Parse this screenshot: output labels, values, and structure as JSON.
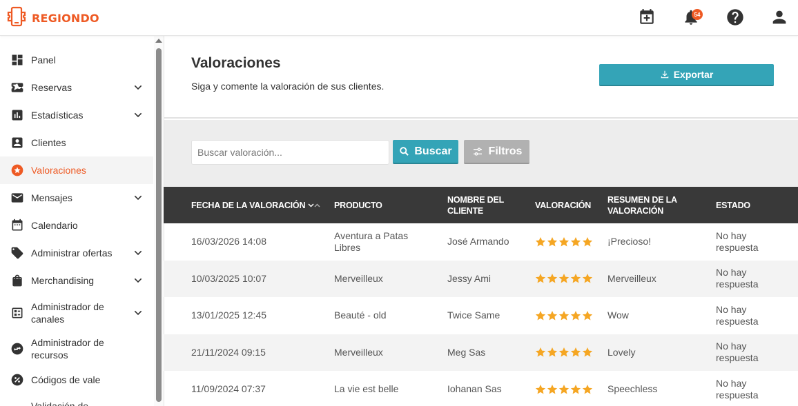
{
  "app": {
    "brand": "REGIONDO",
    "brand_color": "#ee5a24",
    "accent": "#34a4b7"
  },
  "topbar": {
    "icons": [
      "calendar-plus-icon",
      "bell-icon",
      "help-icon",
      "user-icon"
    ],
    "notifications_count": "54"
  },
  "sidebar": {
    "items": [
      {
        "label": "Panel",
        "icon": "dashboard-icon",
        "has_chevron": false
      },
      {
        "label": "Reservas",
        "icon": "ticket-star-icon",
        "has_chevron": true
      },
      {
        "label": "Estadísticas",
        "icon": "bar-chart-icon",
        "has_chevron": true
      },
      {
        "label": "Clientes",
        "icon": "person-box-icon",
        "has_chevron": false
      },
      {
        "label": "Valoraciones",
        "icon": "star-circle-icon",
        "has_chevron": false,
        "active": true
      },
      {
        "label": "Mensajes",
        "icon": "envelope-icon",
        "has_chevron": true
      },
      {
        "label": "Calendario",
        "icon": "calendar-icon",
        "has_chevron": false
      },
      {
        "label": "Administrar ofertas",
        "icon": "tag-icon",
        "has_chevron": true
      },
      {
        "label": "Merchandising",
        "icon": "shopping-bag-icon",
        "has_chevron": true
      },
      {
        "label": "Administrador de canales",
        "icon": "channels-icon",
        "has_chevron": true
      },
      {
        "label": "Administrador de recursos",
        "icon": "swap-icon",
        "has_chevron": false
      },
      {
        "label": "Códigos de vale",
        "icon": "percent-icon",
        "has_chevron": false
      },
      {
        "label": "Validación de",
        "icon": "",
        "has_chevron": false
      }
    ]
  },
  "header": {
    "title": "Valoraciones",
    "subtitle": "Siga y comente la valoración de sus clientes.",
    "export_label": "Exportar"
  },
  "filters": {
    "search_placeholder": "Buscar valoración...",
    "search_value": "",
    "search_button": "Buscar",
    "filters_button": "Filtros"
  },
  "table": {
    "columns": [
      "Fecha de la valoración",
      "Producto",
      "Nombre del cliente",
      "Valoración",
      "Resumen de la valoración",
      "Estado"
    ],
    "rows": [
      {
        "fecha": "16/03/2026 14:08",
        "producto": "Aventura a Patas Libres",
        "cliente": "José Armando",
        "rating": 5,
        "resumen": "¡Precioso!",
        "estado": "No hay respuesta"
      },
      {
        "fecha": "10/03/2025 10:07",
        "producto": "Merveilleux",
        "cliente": "Jessy Ami",
        "rating": 5,
        "resumen": "Merveilleux",
        "estado": "No hay respuesta"
      },
      {
        "fecha": "13/01/2025 12:45",
        "producto": "Beauté - old",
        "cliente": "Twice Same",
        "rating": 5,
        "resumen": "Wow",
        "estado": "No hay respuesta"
      },
      {
        "fecha": "21/11/2024 09:15",
        "producto": "Merveilleux",
        "cliente": "Meg Sas",
        "rating": 5,
        "resumen": "Lovely",
        "estado": "No hay respuesta"
      },
      {
        "fecha": "11/09/2024 07:37",
        "producto": "La vie est belle",
        "cliente": "Iohanan Sas",
        "rating": 5,
        "resumen": "Speechless",
        "estado": "No hay respuesta"
      }
    ],
    "star_color": "#f5a623"
  }
}
